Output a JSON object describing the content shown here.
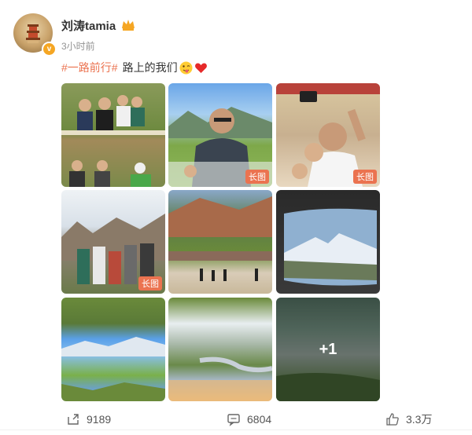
{
  "post": {
    "username": "刘涛tamia",
    "time": "3小时前",
    "hashtag": "#一路前行#",
    "text": "路上的我们",
    "emoji": [
      "tongue-face",
      "heart"
    ]
  },
  "images": [
    {
      "name": "group-photo-hillside",
      "badge": ""
    },
    {
      "name": "man-with-sunglasses-meadow",
      "badge": "长图"
    },
    {
      "name": "group-selfie-temple",
      "badge": "长图"
    },
    {
      "name": "group-photo-mountains",
      "badge": "长图"
    },
    {
      "name": "valley-river-walkers",
      "badge": ""
    },
    {
      "name": "car-window-snow-peak",
      "badge": ""
    },
    {
      "name": "green-hills-blue-sky",
      "badge": ""
    },
    {
      "name": "river-valley-clouds",
      "badge": ""
    },
    {
      "name": "misty-mountains",
      "badge": "+1"
    }
  ],
  "footer": {
    "shares": "9189",
    "comments": "6804",
    "likes": "3.3万"
  },
  "colors": {
    "accent": "#eb7350",
    "verified": "#f5a623"
  }
}
